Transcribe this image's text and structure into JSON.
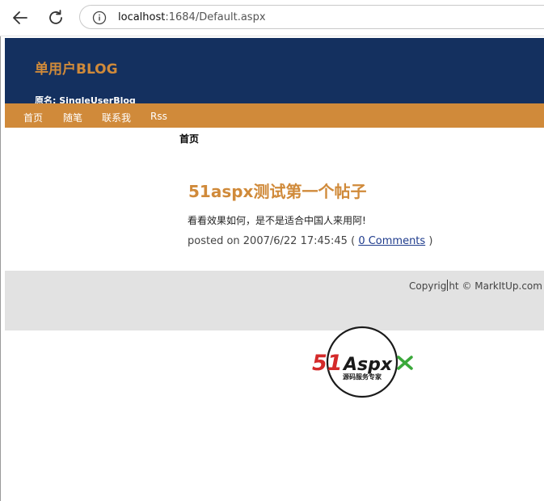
{
  "browser": {
    "url_host": "localhost",
    "url_rest": ":1684/Default.aspx",
    "back_icon": "arrow-left-icon",
    "reload_icon": "reload-icon",
    "info_icon": "info-icon"
  },
  "header": {
    "title": "单用户BLOG",
    "subtitle": "原名: SingleUserBlog"
  },
  "menu": {
    "items": [
      "首页",
      "随笔",
      "联系我",
      "Rss"
    ]
  },
  "breadcrumb": "首页",
  "post": {
    "title": "51aspx测试第一个帖子",
    "body": "看看效果如何，是不是适合中国人来用阿!",
    "meta_prefix": "posted on 2007/6/22 17:45:45 (",
    "comments_link": "0 Comments",
    "meta_suffix": ")"
  },
  "footer": {
    "copyright_a": "Copyrig",
    "copyright_b": "ht © MarkItUp.com"
  },
  "logo": {
    "mark_a": "51",
    "mark_b": "Aspx",
    "tagline": "源码服务专家"
  },
  "colors": {
    "header_bg": "#14305f",
    "accent": "#d08a3a",
    "footer_bg": "#e2e2e2",
    "link": "#1e3b8c",
    "logo_red": "#d42a2a",
    "logo_green": "#3aa83a"
  }
}
